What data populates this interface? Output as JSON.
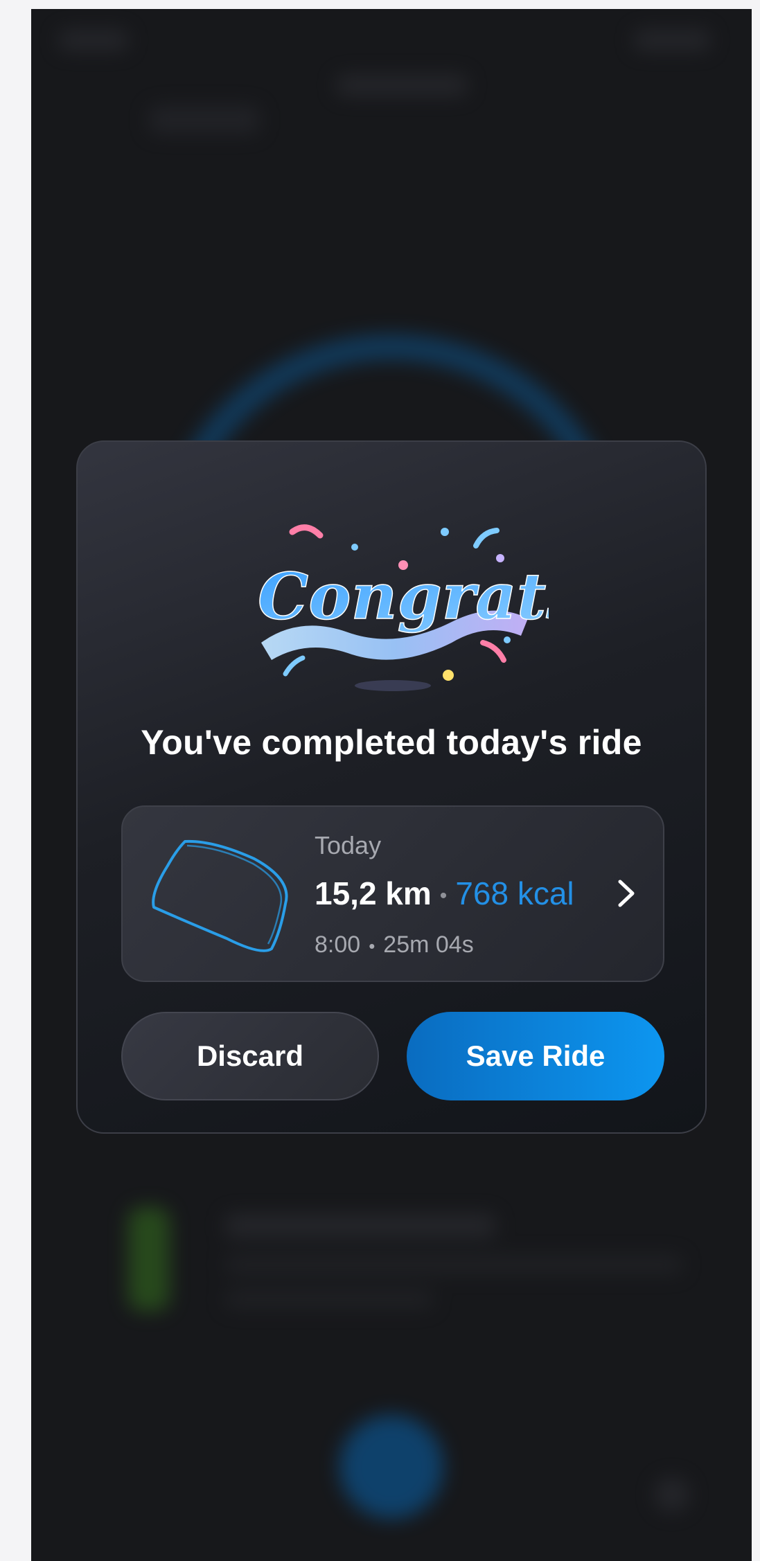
{
  "dialog": {
    "banner_text": "Congrats!",
    "title": "You've completed today's ride"
  },
  "ride": {
    "day": "Today",
    "distance": "15,2 km",
    "separator": "•",
    "calories": "768 kcal",
    "start_time": "8:00",
    "duration": "25m 04s"
  },
  "actions": {
    "discard_label": "Discard",
    "save_label": "Save Ride"
  },
  "colors": {
    "accent": "#0d96f0",
    "calories": "#2390e6",
    "route": "#2a9ee8",
    "background": "#17181b"
  },
  "icons": {
    "route": "route-map-icon",
    "chevron": "chevron-right-icon"
  }
}
